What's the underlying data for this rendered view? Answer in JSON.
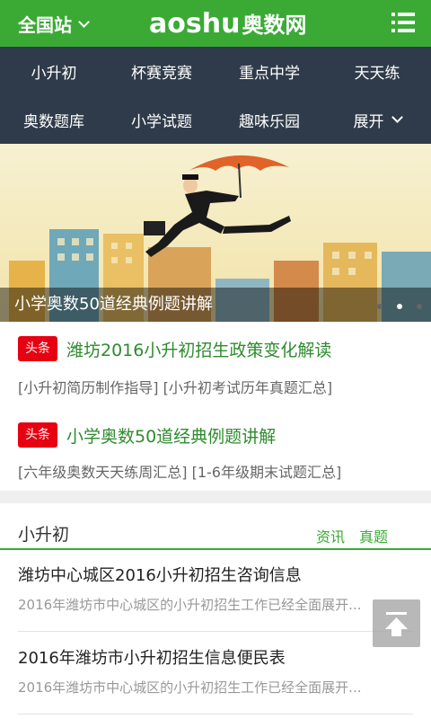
{
  "header": {
    "site_label": "全国站",
    "logo_en": "aoshu",
    "logo_cn": "奥数网"
  },
  "nav": {
    "items": [
      "小升初",
      "杯赛竞赛",
      "重点中学",
      "天天练",
      "奥数题库",
      "小学试题",
      "趣味乐园",
      "展开"
    ]
  },
  "banner": {
    "caption": "小学奥数50道经典例题讲解",
    "slide_count": 3,
    "active_slide": 2
  },
  "headlines": [
    {
      "tag": "头条",
      "title": "潍坊2016小升初招生政策变化解读",
      "links": "[小升初简历制作指导] [小升初考试历年真题汇总]"
    },
    {
      "tag": "头条",
      "title": "小学奥数50道经典例题讲解",
      "links": "[六年级奥数天天练周汇总] [1-6年级期末试题汇总]"
    }
  ],
  "section": {
    "title": "小升初",
    "link1": "资讯",
    "link2": "真题"
  },
  "articles": [
    {
      "title": "潍坊中心城区2016小升初招生咨询信息",
      "summary": "2016年潍坊市中心城区的小升初招生工作已经全面展开..."
    },
    {
      "title": "2016年潍坊市小升初招生信息便民表",
      "summary": "2016年潍坊市中心城区的小升初招生工作已经全面展开..."
    }
  ],
  "colors": {
    "brand_green": "#3aaa35",
    "nav_bg": "#2f3b4a",
    "tag_red": "#e60012"
  },
  "icons": {
    "menu": "list-menu-icon",
    "back_to_top": "arrow-up-to-top-icon"
  }
}
